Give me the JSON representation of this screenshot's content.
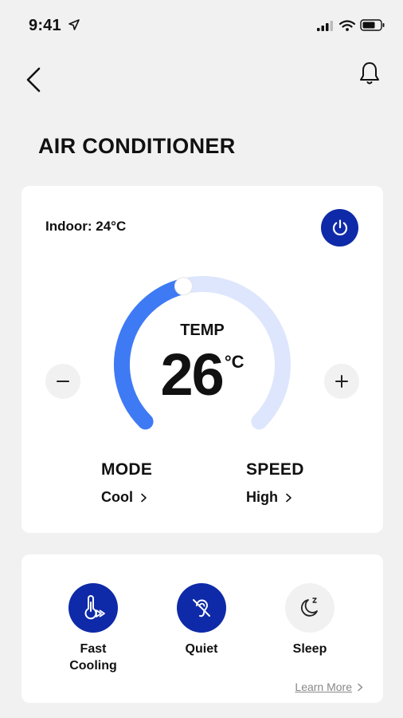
{
  "status_bar": {
    "time": "9:41"
  },
  "header": {
    "title": "AIR CONDITIONER"
  },
  "main_card": {
    "indoor": "Indoor: 24°C",
    "temp_label": "TEMP",
    "temp_value": "26",
    "temp_unit": "°C",
    "dial_level": 0.45,
    "mode": {
      "label": "MODE",
      "value": "Cool"
    },
    "speed": {
      "label": "SPEED",
      "value": "High"
    }
  },
  "modes_card": {
    "items": [
      {
        "label": "Fast\nCooling",
        "active": true,
        "icon": "thermometer-fast-icon"
      },
      {
        "label": "Quiet",
        "active": true,
        "icon": "ear-off-icon"
      },
      {
        "label": "Sleep",
        "active": false,
        "icon": "moon-sleep-icon"
      }
    ],
    "learn_more": "Learn More"
  },
  "colors": {
    "accent": "#0e2aa8",
    "dial_active": "#3f7af5",
    "dial_track": "#dde6fc"
  }
}
